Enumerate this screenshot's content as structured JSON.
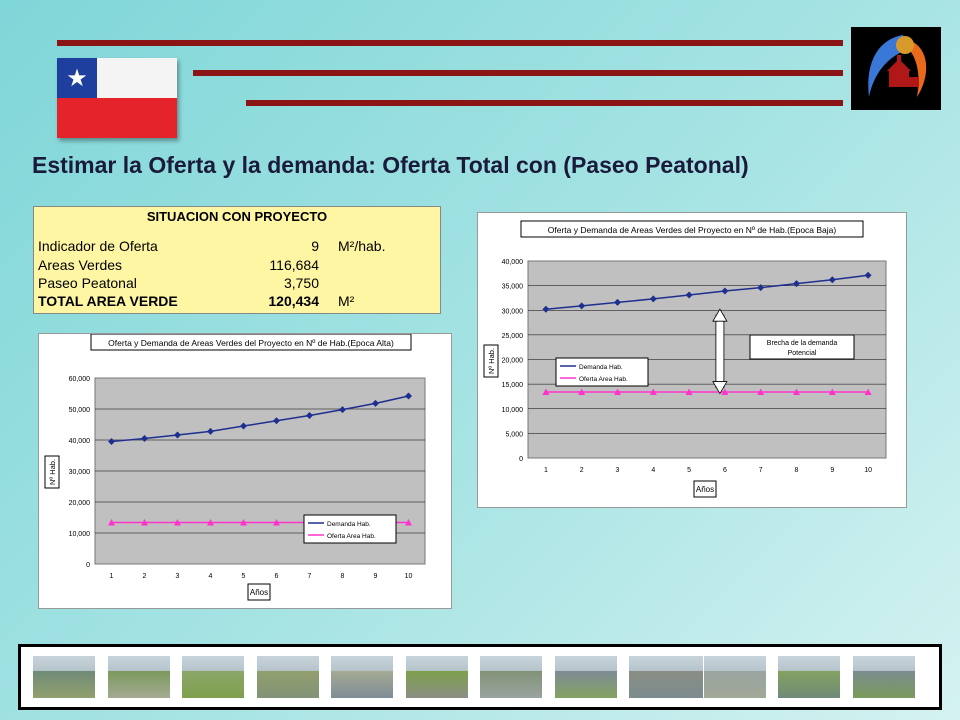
{
  "title": "Estimar la Oferta y la demanda: Oferta Total con (Paseo Peatonal)",
  "colors": {
    "bars": "#8b1414",
    "demand": "#1f2f8f",
    "supply": "#ff33cc",
    "plot_bg": "#c0c0c0",
    "table_bg": "#fff6a4"
  },
  "flag_icon": "chile-flag-icon",
  "logo_icon": "municipal-logo-icon",
  "table": {
    "header": "SITUACION CON PROYECTO",
    "rows": [
      {
        "label": "Indicador de Oferta",
        "value": "9",
        "unit": "M²/hab."
      },
      {
        "label": "Areas Verdes",
        "value": "116,684",
        "unit": ""
      },
      {
        "label": "Paseo Peatonal",
        "value": "3,750",
        "unit": ""
      },
      {
        "label": "TOTAL AREA VERDE",
        "value": "120,434",
        "unit": "M²"
      }
    ]
  },
  "chart_data": [
    {
      "type": "line",
      "title": "Oferta y Demanda de Areas Verdes del Proyecto en Nº de Hab.(Epoca Alta)",
      "xlabel": "Años",
      "ylabel": "Nº Hab.",
      "x": [
        1,
        2,
        3,
        4,
        5,
        6,
        7,
        8,
        9,
        10
      ],
      "ylim": [
        0,
        60000
      ],
      "yticks": [
        "0",
        "10,000",
        "20,000",
        "30,000",
        "40,000",
        "50,000",
        "60,000"
      ],
      "grid": true,
      "legend": "inside-bottom-right",
      "series": [
        {
          "name": "Demanda Hab.",
          "values": [
            39500,
            40500,
            41600,
            42800,
            44500,
            46200,
            47900,
            49800,
            51800,
            54200
          ]
        },
        {
          "name": "Oferta Area Hab.",
          "values": [
            13400,
            13400,
            13400,
            13400,
            13400,
            13400,
            13400,
            13400,
            13400,
            13400
          ]
        }
      ]
    },
    {
      "type": "line",
      "title": "Oferta y Demanda de Areas Verdes del Proyecto en Nº de Hab.(Epoca Baja)",
      "xlabel": "Años",
      "ylabel": "Nº Hab.",
      "x": [
        1,
        2,
        3,
        4,
        5,
        6,
        7,
        8,
        9,
        10
      ],
      "ylim": [
        0,
        40000
      ],
      "yticks": [
        "0",
        "5,000",
        "10,000",
        "15,000",
        "20,000",
        "25,000",
        "30,000",
        "35,000",
        "40,000"
      ],
      "grid": true,
      "legend": "inside-left",
      "annotation": "Brecha de la demanda Potencial",
      "series": [
        {
          "name": "Demanda Hab.",
          "values": [
            30200,
            30900,
            31600,
            32300,
            33100,
            33900,
            34600,
            35400,
            36200,
            37100
          ]
        },
        {
          "name": "Oferta Area Hab.",
          "values": [
            13400,
            13400,
            13400,
            13400,
            13400,
            13400,
            13400,
            13400,
            13400,
            13400
          ]
        }
      ]
    }
  ],
  "photos": [
    "river-photo-icon",
    "trees-photo-icon",
    "river-photo-icon",
    "path-photo-icon",
    "field-photo-icon",
    "grass-photo-icon",
    "trees-photo-icon",
    "river-photo-icon",
    "bridge-photo-icon",
    "field-photo-icon",
    "trees-photo-icon",
    "river-photo-icon",
    "field-photo-icon"
  ]
}
